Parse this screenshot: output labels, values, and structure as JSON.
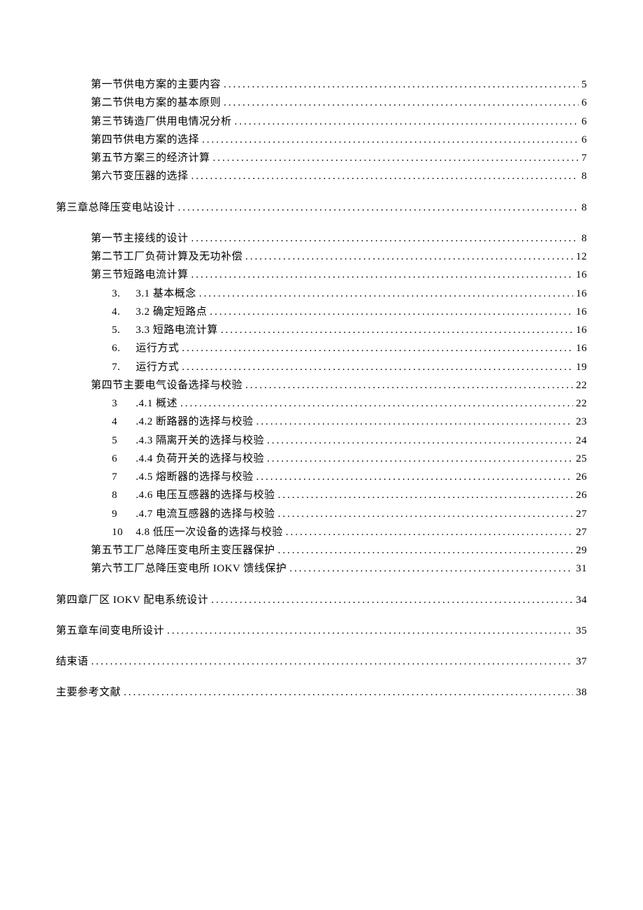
{
  "toc": [
    {
      "indent": 1,
      "text": "第一节供电方案的主要内容",
      "page": "5",
      "gap": false
    },
    {
      "indent": 1,
      "text": "第二节供电方案的基本原则",
      "page": "6",
      "gap": false
    },
    {
      "indent": 1,
      "text": "第三节铸造厂供用电情况分析",
      "page": "6",
      "gap": false
    },
    {
      "indent": 1,
      "text": "第四节供电方案的选择",
      "page": "6",
      "gap": false
    },
    {
      "indent": 1,
      "text": "第五节方案三的经济计算",
      "page": "7",
      "gap": false
    },
    {
      "indent": 1,
      "text": "第六节变压器的选择",
      "page": "8",
      "gap": false
    },
    {
      "indent": 0,
      "text": "第三章总降压变电站设计",
      "page": "8",
      "gap": true
    },
    {
      "indent": 1,
      "text": "第一节主接线的设计",
      "page": "8",
      "gap": true
    },
    {
      "indent": 1,
      "text": "第二节工厂负荷计算及无功补偿",
      "page": "12",
      "gap": false
    },
    {
      "indent": 1,
      "text": "第三节短路电流计算",
      "page": "16",
      "gap": false
    },
    {
      "indent": 2,
      "num": "3.",
      "text": "3.1   基本概念",
      "page": "16",
      "gap": false
    },
    {
      "indent": 2,
      "num": "4.",
      "text": "3.2 确定短路点",
      "page": "16",
      "gap": false
    },
    {
      "indent": 2,
      "num": "5.",
      "text": "3.3 短路电流计算",
      "page": "16",
      "gap": false
    },
    {
      "indent": 2,
      "num": "6.",
      "text": "     运行方式",
      "page": "16",
      "gap": false
    },
    {
      "indent": 2,
      "num": "7.",
      "text": "     运行方式",
      "page": "19",
      "gap": false
    },
    {
      "indent": 1,
      "text": "第四节主要电气设备选择与校验",
      "page": "22",
      "gap": false
    },
    {
      "indent": 2,
      "num": "3",
      "text": ".4.1    概述",
      "page": "22",
      "gap": false
    },
    {
      "indent": 2,
      "num": "4",
      "text": ".4.2 断路器的选择与校验",
      "page": "23",
      "gap": false
    },
    {
      "indent": 2,
      "num": "5",
      "text": ".4.3 隔离开关的选择与校验",
      "page": "24",
      "gap": false
    },
    {
      "indent": 2,
      "num": "6",
      "text": ".4.4 负荷开关的选择与校验",
      "page": "25",
      "gap": false
    },
    {
      "indent": 2,
      "num": "7",
      "text": ".4.5 熔断器的选择与校验",
      "page": "26",
      "gap": false
    },
    {
      "indent": 2,
      "num": "8",
      "text": ".4.6 电压互感器的选择与校验",
      "page": "26",
      "gap": false
    },
    {
      "indent": 2,
      "num": "9",
      "text": ".4.7 电流互感器的选择与校验",
      "page": "27",
      "gap": false
    },
    {
      "indent": 2,
      "num": "10",
      "text": "4.8 低压一次设备的选择与校验",
      "page": "27",
      "gap": false
    },
    {
      "indent": 1,
      "text": "第五节工厂总降压变电所主变压器保护",
      "page": "29",
      "gap": false
    },
    {
      "indent": 1,
      "text": "第六节工厂总降压变电所 IOKV 馈线保护",
      "page": "31",
      "gap": false
    },
    {
      "indent": 0,
      "text": "第四章厂区 IOKV 配电系统设计",
      "page": "34",
      "gap": true
    },
    {
      "indent": 0,
      "text": "第五章车间变电所设计",
      "page": "35",
      "gap": true
    },
    {
      "indent": 0,
      "text": "结束语",
      "page": "37",
      "gap": true
    },
    {
      "indent": 0,
      "text": "主要参考文献",
      "page": "38",
      "gap": true
    }
  ]
}
